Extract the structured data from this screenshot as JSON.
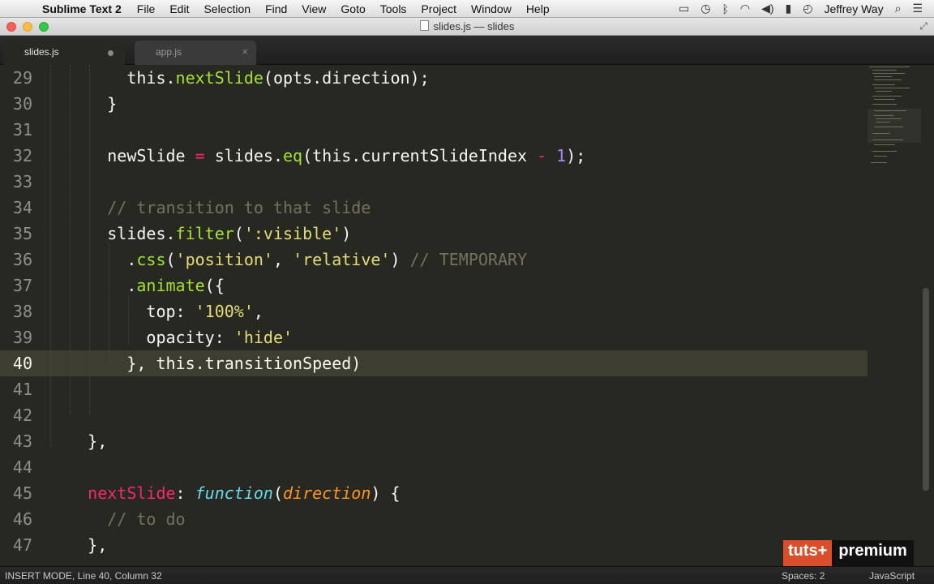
{
  "menubar": {
    "app_name": "Sublime Text 2",
    "items": [
      "File",
      "Edit",
      "Selection",
      "Find",
      "View",
      "Goto",
      "Tools",
      "Project",
      "Window",
      "Help"
    ],
    "user": "Jeffrey Way"
  },
  "window": {
    "title": "slides.js — slides"
  },
  "tabs": [
    {
      "label": "slides.js",
      "active": true,
      "modified": true
    },
    {
      "label": "app.js",
      "active": false
    }
  ],
  "editor": {
    "current_line": 40,
    "line_numbers": [
      "29",
      "30",
      "31",
      "32",
      "33",
      "34",
      "35",
      "36",
      "37",
      "38",
      "39",
      "40",
      "41",
      "42",
      "43",
      "44",
      "45",
      "46",
      "47"
    ]
  },
  "statusbar": {
    "left": "INSERT MODE, Line 40, Column 32",
    "spaces": "Spaces: 2",
    "syntax": "JavaScript"
  },
  "watermark": {
    "a": "tuts+",
    "b": "premium"
  },
  "colors": {
    "background": "#272822",
    "keyword": "#f92672",
    "string": "#e6db74",
    "comment": "#75715e",
    "function": "#66d9ef",
    "method": "#a6e22e",
    "param": "#fd971f",
    "number": "#ae81ff",
    "brand": "#d94f2b"
  }
}
